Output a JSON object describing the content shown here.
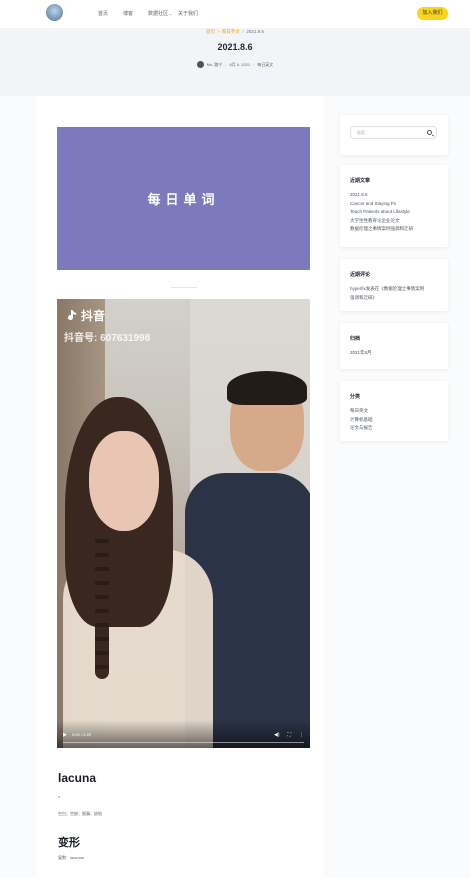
{
  "header": {
    "nav": [
      "首页",
      "博客",
      "数据社区",
      "关于我们"
    ],
    "join_label": "加入我们"
  },
  "hero": {
    "breadcrumb": [
      "首页",
      "每日英文",
      "2021.8.6"
    ],
    "title": "2021.8.6",
    "meta": {
      "author": "Ms. 路宁",
      "date": "8月 6, 2021",
      "category": "每日英文"
    }
  },
  "post": {
    "banner_text": "每日单词",
    "video": {
      "watermark_app": "抖音",
      "watermark_id": "抖音号: 607631998",
      "time": "0:00 / 0:25"
    },
    "word1": "lacuna",
    "word1_phonetic": "n.",
    "word1_def": "空白；空缺；脱漏；缺陷",
    "word2": "变形",
    "word2_def": "复数：lacunae"
  },
  "sidebar": {
    "search_placeholder": "搜索",
    "recent_title": "近期文章",
    "recent": [
      "2021.8.6",
      "Cancer and Staying Fit",
      "Teach Patients about Lifestyle",
      "大学生性教育论企业论文",
      "数据伦理之事情案例强调和迂研"
    ],
    "comments_title": "近期评论",
    "comments": [
      "hyperfix发表在《数据伦理之事情案例",
      "强调和迂研》"
    ],
    "archive_title": "归档",
    "archive": [
      "2021年8月"
    ],
    "cats_title": "分类",
    "cats": [
      "每日英文",
      "计算机基础",
      "论文与报告"
    ]
  },
  "colors": {
    "accent": "#fbd51a",
    "breadcrumb": "#f0a500",
    "banner": "#7c79bd"
  }
}
